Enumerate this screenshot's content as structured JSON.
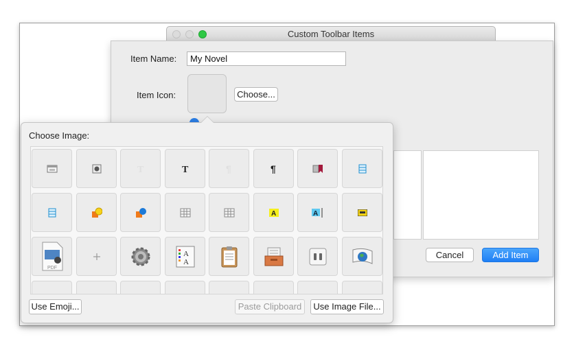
{
  "window": {
    "title": "Custom Toolbar Items"
  },
  "form": {
    "item_name_label": "Item Name:",
    "item_name_value": "My Novel",
    "item_icon_label": "Item Icon:",
    "choose_label": "Choose...",
    "cancel_label": "Cancel",
    "add_item_label": "Add Item"
  },
  "picker": {
    "title": "Choose Image:",
    "use_emoji_label": "Use Emoji...",
    "paste_clipboard_label": "Paste Clipboard",
    "use_image_file_label": "Use Image File...",
    "icons": [
      [
        "window-layout-icon",
        "gear-badge-icon",
        "faded-text-icon",
        "text-bold-icon",
        "faded-pilcrow-icon",
        "pilcrow-icon",
        "bookmark-icon",
        "blue-document-icon"
      ],
      [
        "blue-document-icon",
        "shapes-icon",
        "shapes-blue-icon",
        "table-icon",
        "table-icon",
        "highlight-icon",
        "text-highlight-icon",
        "ruler-icon"
      ],
      [
        "pdf-document-icon",
        "plus-icon",
        "gear-icon",
        "font-panel-icon",
        "clipboard-icon",
        "inbox-tray-icon",
        "switches-icon",
        "globe-flag-icon"
      ],
      [
        "partial-icon",
        "partial-icon",
        "partial-icon",
        "partial-icon",
        "partial-icon",
        "partial-icon",
        "partial-icon",
        "partial-icon"
      ]
    ],
    "pdf_caption": "PDF"
  },
  "colors": {
    "accent": "#2f86f6",
    "green": "#2fc845"
  }
}
